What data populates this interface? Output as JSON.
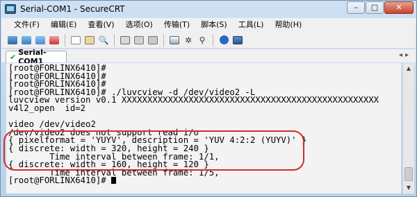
{
  "window": {
    "title": "Serial-COM1 - SecureCRT"
  },
  "window_controls": {
    "minimize": "–",
    "maximize": "□",
    "close": "✕"
  },
  "menu": [
    {
      "label": "文件(F)"
    },
    {
      "label": "编辑(E)"
    },
    {
      "label": "查看(V)"
    },
    {
      "label": "选项(O)"
    },
    {
      "label": "传输(T)"
    },
    {
      "label": "脚本(S)"
    },
    {
      "label": "工具(L)"
    },
    {
      "label": "帮助(H)"
    }
  ],
  "toolbar": {
    "icons": [
      "connect-icon",
      "quick-connect-icon",
      "connect-tab-icon",
      "disconnect-icon",
      "copy-icon",
      "paste-icon",
      "find-icon",
      "print-icon",
      "print-selection-icon",
      "print-screen-icon",
      "sftp-icon",
      "key-map-icon",
      "key-icon",
      "help-icon",
      "about-icon"
    ]
  },
  "tabs": [
    {
      "label": "Serial-COM1",
      "status": "✔"
    }
  ],
  "terminal": {
    "lines": [
      "[root@FORLINX6410]#",
      "[root@FORLINX6410]#",
      "[root@FORLINX6410]#",
      "[root@FORLINX6410]# ./luvcview -d /dev/video2 -L",
      "luvcview version v0.1 XXXXXXXXXXXXXXXXXXXXXXXXXXXXXXXXXXXXXXXXXXXXXXXXXX",
      "v4l2_open  id=2",
      "",
      "video /dev/video2",
      "/dev/video2 does not support read i/o",
      "{ pixelformat = 'YUYV', description = 'YUV 4:2:2 (YUYV)' }",
      "{ discrete: width = 320, height = 240 }",
      "        Time interval between frame: 1/1,",
      "{ discrete: width = 160, height = 120 }",
      "        Time interval between frame: 1/5,",
      "[root@FORLINX6410]# "
    ]
  },
  "colors": {
    "annotation": "#d22b2b",
    "terminal_bg": "#f3f3f3"
  }
}
